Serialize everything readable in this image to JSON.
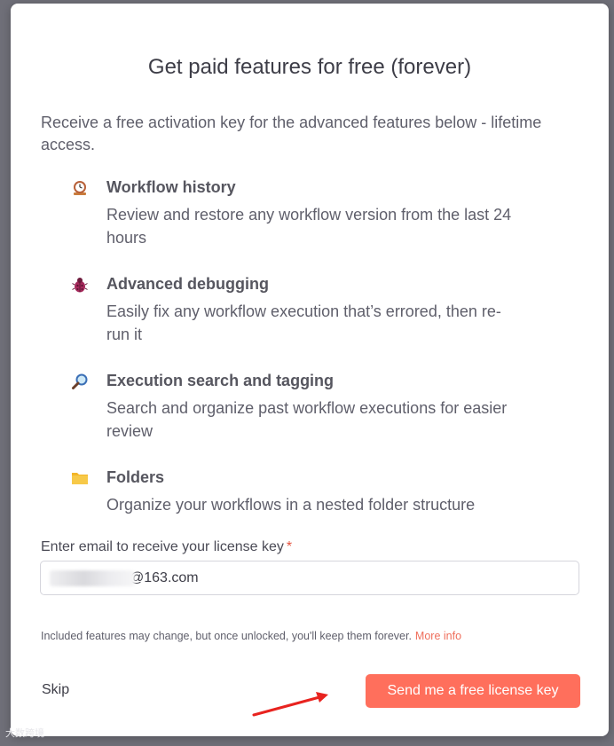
{
  "modal": {
    "title": "Get paid features for free (forever)",
    "intro": "Receive a free activation key for the advanced features below - lifetime access."
  },
  "features": [
    {
      "icon": "clock-icon",
      "title": "Workflow history",
      "description": "Review and restore any workflow version from the last 24 hours"
    },
    {
      "icon": "bug-icon",
      "title": "Advanced debugging",
      "description": "Easily fix any workflow execution that’s errored, then re-run it"
    },
    {
      "icon": "magnifier-icon",
      "title": "Execution search and tagging",
      "description": "Search and organize past workflow executions for easier review"
    },
    {
      "icon": "folder-icon",
      "title": "Folders",
      "description": "Organize your workflows in a nested folder structure"
    }
  ],
  "form": {
    "email_label": "Enter email to receive your license key",
    "required_mark": "*",
    "email_value": "@163.com"
  },
  "notice": {
    "text": "Included features may change, but once unlocked, you'll keep them forever.",
    "more_link": "More info"
  },
  "actions": {
    "skip_label": "Skip",
    "cta_label": "Send me a free license key"
  },
  "watermark": "大数跨境",
  "colors": {
    "accent": "#ff6f5c",
    "link": "#ef6e5b",
    "required": "#e4533f",
    "backdrop": "#6f6f78",
    "annotation_arrow": "#e8231f"
  }
}
